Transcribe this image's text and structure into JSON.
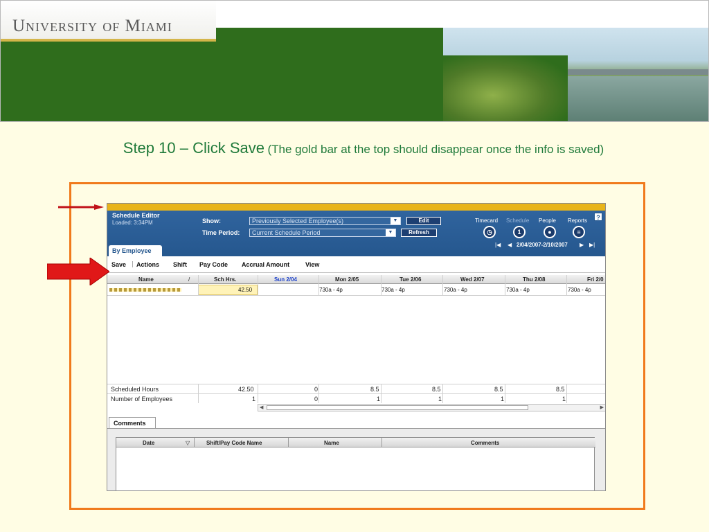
{
  "banner": {
    "logo_text": "University of Miami"
  },
  "caption": {
    "main": "Step 10 – Click Save",
    "sub": "(The gold bar at the top should disappear once the info is saved)"
  },
  "colors": {
    "frame": "#f07a1c",
    "arrow": "#e01818",
    "gold_bar": "#e8b41a",
    "caption": "#1f7a3a"
  },
  "app": {
    "title": "Schedule Editor",
    "loaded": "Loaded: 3:34PM",
    "show_label": "Show:",
    "show_value": "Previously Selected Employee(s)",
    "edit_button": "Edit",
    "time_period_label": "Time Period:",
    "time_period_value": "Current Schedule Period",
    "refresh_button": "Refresh",
    "nav": [
      "Timecard",
      "Schedule",
      "People",
      "Reports"
    ],
    "help": "?",
    "date_range": "2/04/2007-2/10/2007",
    "tab": "By Employee",
    "menu": [
      "Save",
      "Actions",
      "Shift",
      "Pay Code",
      "Accrual Amount",
      "View"
    ],
    "columns": [
      "Name",
      "Sch Hrs.",
      "Sun 2/04",
      "Mon 2/05",
      "Tue 2/06",
      "Wed 2/07",
      "Thu 2/08",
      "Fri 2/0"
    ],
    "row": {
      "sch_hrs": "42.50",
      "mon": "730a - 4p",
      "tue": "730a - 4p",
      "wed": "730a - 4p",
      "thu": "730a - 4p",
      "fri": "730a - 4p"
    },
    "summary_scheduled": {
      "label": "Scheduled Hours",
      "values": [
        "42.50",
        "0",
        "8.5",
        "8.5",
        "8.5",
        "8.5"
      ]
    },
    "summary_employees": {
      "label": "Number of Employees",
      "values": [
        "1",
        "0",
        "1",
        "1",
        "1",
        "1"
      ]
    },
    "comments_tab": "Comments",
    "comments_columns": [
      "Date",
      "Shift/Pay Code Name",
      "Name",
      "Comments"
    ]
  }
}
